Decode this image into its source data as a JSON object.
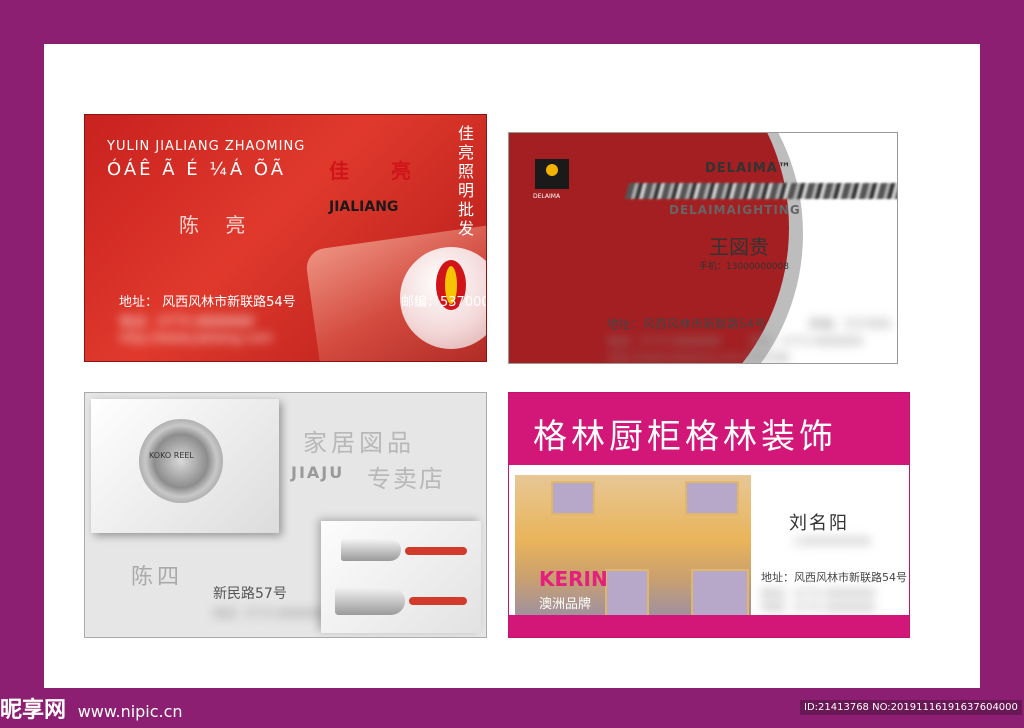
{
  "colors": {
    "background": "#8c1f72",
    "card1_red": "#c9211f",
    "card2_red": "#a31f22",
    "card4_magenta": "#d31779"
  },
  "card1": {
    "brand_en": "YULIN JIALIANG ZHAOMING",
    "garbled": "ÓÁÊ Ã É ¼Á ÕÃ",
    "logo_left": "佳",
    "logo_right": "亮",
    "logo_en": "JIALIANG",
    "vertical_text": "佳亮照明批发",
    "name": "陈 亮",
    "address": "地址：  风西风林市新联路54号",
    "postcode": "邮编：537000",
    "phone": "电话：0775-8888888",
    "web": "http://www.jialiang.com"
  },
  "card2": {
    "logo_en": "DELAIMA",
    "logo_tm": "DELAIMA™",
    "subtitle": "DELAIMAIGHTING",
    "name": "王図贵",
    "mobile": "手机：13000000008",
    "address": "地址：风西风林市新联路54号",
    "postcode": "邮编：537000",
    "phone": "电话：0775-8888888",
    "fax": "传真：0775-8888888",
    "web": "http://www.delaima.com 欢迎光临"
  },
  "card3": {
    "title_cn": "家居図品",
    "title_en": "JIAJU",
    "title_shop": "专卖店",
    "reel_label": "KOKO REEL",
    "name": "陈四",
    "address": "新民路57号",
    "phone": "电话：0775-8888888"
  },
  "card4": {
    "title": "格林厨柜格林装饰",
    "brand": "KERIN",
    "brand_sub": "澳洲品牌",
    "name": "刘名阳",
    "mobile": "13000000008",
    "address": "地址：风西风林市新联路54号",
    "phone": "电话：0775-8888888",
    "fax": "传真：0775-8888888"
  },
  "watermark": {
    "logo": "昵享网",
    "site": "www.nipic.cn",
    "id": "ID:21413768 NO:20191116191637604000"
  }
}
